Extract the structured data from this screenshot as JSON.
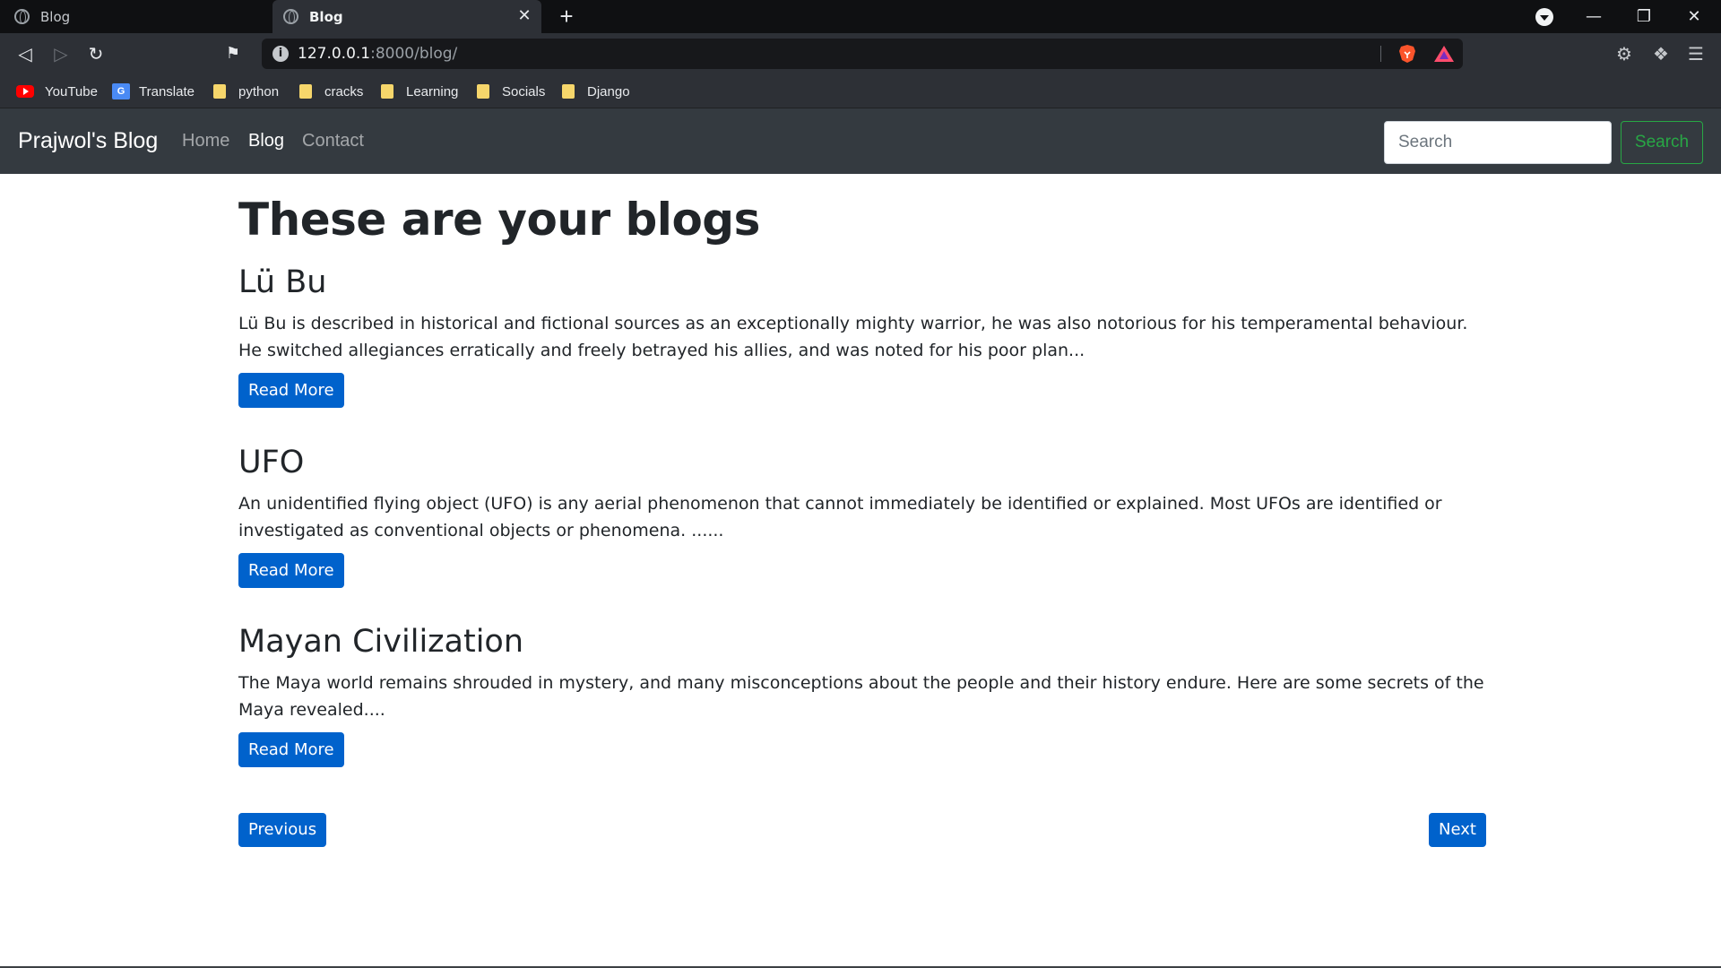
{
  "browser": {
    "tabs": [
      {
        "title": "Blog",
        "active": false
      },
      {
        "title": "Blog",
        "active": true
      }
    ],
    "new_tab_glyph": "+",
    "tab_close_glyph": "✕",
    "url_host": "127.0.0.1",
    "url_rest": ":8000/blog/",
    "bookmarks": [
      {
        "label": "YouTube",
        "icon": "youtube-icon"
      },
      {
        "label": "Translate",
        "icon": "google-translate-icon"
      },
      {
        "label": "python",
        "icon": "folder-icon"
      },
      {
        "label": "cracks",
        "icon": "folder-icon"
      },
      {
        "label": "Learning",
        "icon": "folder-icon"
      },
      {
        "label": "Socials",
        "icon": "folder-icon"
      },
      {
        "label": "Django",
        "icon": "folder-icon"
      }
    ]
  },
  "navbar": {
    "brand": "Prajwol's Blog",
    "links": [
      {
        "label": "Home",
        "active": false
      },
      {
        "label": "Blog",
        "active": true
      },
      {
        "label": "Contact",
        "active": false
      }
    ],
    "search_placeholder": "Search",
    "search_button": "Search"
  },
  "main": {
    "title": "These are your blogs",
    "posts": [
      {
        "title": "Lü Bu",
        "excerpt": "Lü Bu is described in historical and fictional sources as an exceptionally mighty warrior, he was also notorious for his temperamental behaviour. He switched allegiances erratically and freely betrayed his allies, and was noted for his poor plan...",
        "button": "Read More"
      },
      {
        "title": "UFO",
        "excerpt": "An unidentified flying object (UFO) is any aerial phenomenon that cannot immediately be identified or explained. Most UFOs are identified or investigated as conventional objects or phenomena. ......",
        "button": "Read More"
      },
      {
        "title": "Mayan Civilization",
        "excerpt": "The Maya world remains shrouded in mystery, and many misconceptions about the people and their history endure. Here are some secrets of the Maya revealed....",
        "button": "Read More"
      }
    ],
    "previous": "Previous",
    "next": "Next"
  },
  "colors": {
    "navbar_bg": "#343a40",
    "primary": "#0062cc",
    "success": "#28a745"
  }
}
